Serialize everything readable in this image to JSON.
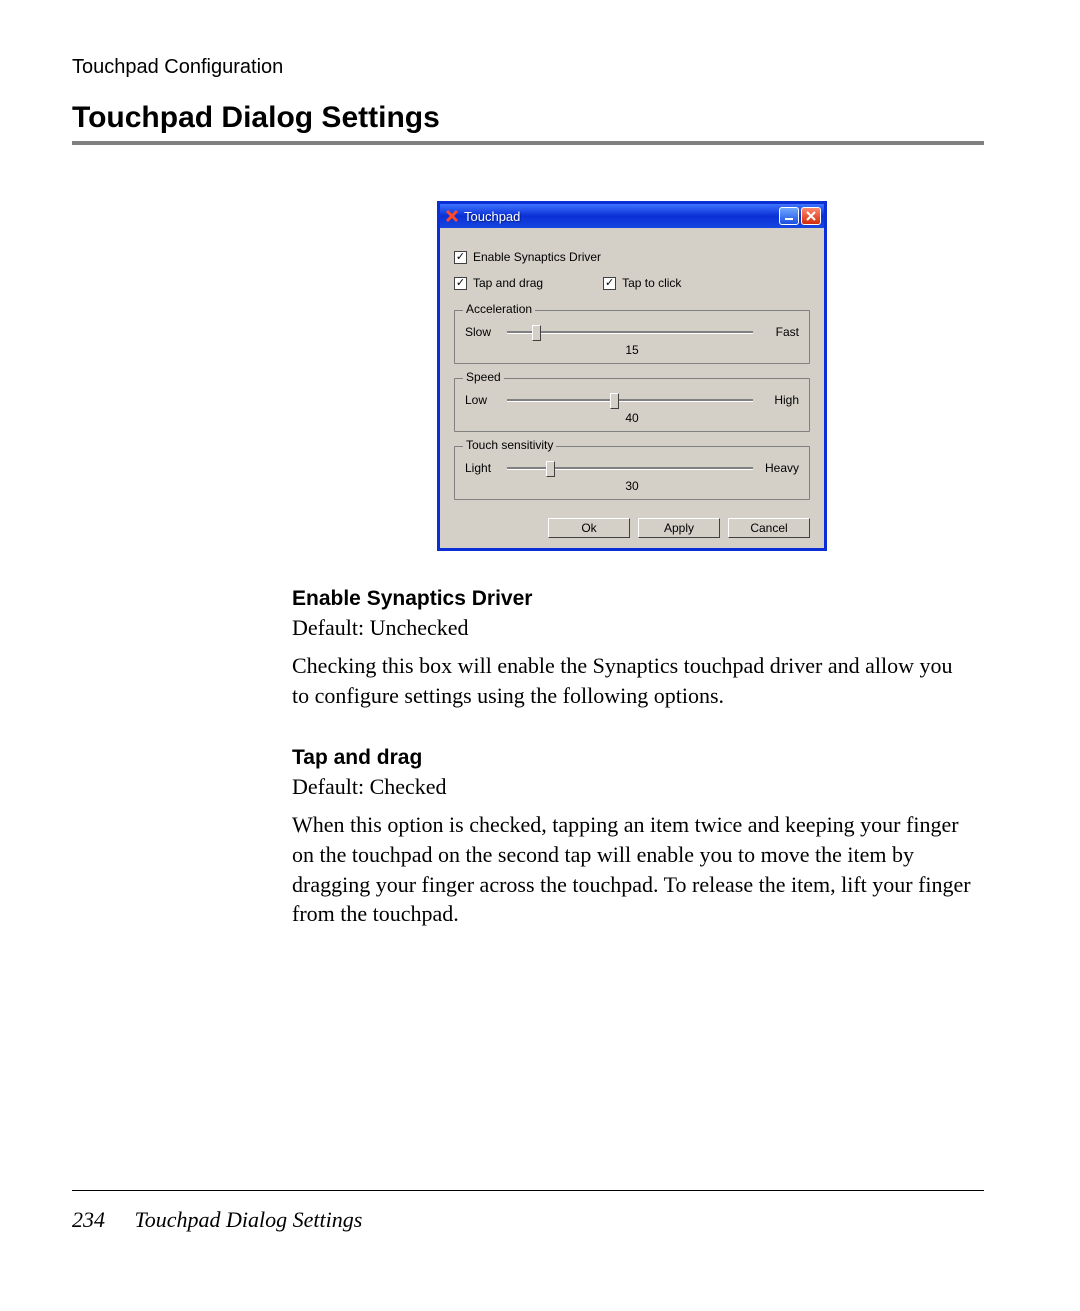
{
  "header": {
    "running_head": "Touchpad Configuration",
    "section_title": "Touchpad Dialog Settings"
  },
  "dialog": {
    "title": "Touchpad",
    "checkboxes": {
      "enable_driver": {
        "label": "Enable Synaptics Driver",
        "checked": true
      },
      "tap_and_drag": {
        "label": "Tap and drag",
        "checked": true
      },
      "tap_to_click": {
        "label": "Tap to click",
        "checked": true
      }
    },
    "groups": {
      "acceleration": {
        "legend": "Acceleration",
        "left_label": "Slow",
        "right_label": "Fast",
        "value": 15,
        "thumb_percent": 10
      },
      "speed": {
        "legend": "Speed",
        "left_label": "Low",
        "right_label": "High",
        "value": 40,
        "thumb_percent": 42
      },
      "sensitivity": {
        "legend": "Touch sensitivity",
        "left_label": "Light",
        "right_label": "Heavy",
        "value": 30,
        "thumb_percent": 16
      }
    },
    "buttons": {
      "ok": "Ok",
      "apply": "Apply",
      "cancel": "Cancel"
    }
  },
  "doc": {
    "opt1": {
      "heading": "Enable Synaptics Driver",
      "default": "Default: Unchecked",
      "body": "Checking this box will enable the Synaptics touchpad driver and allow you to configure settings using the following options."
    },
    "opt2": {
      "heading": "Tap and drag",
      "default": "Default: Checked",
      "body": "When this option is checked, tapping an item  twice and keeping your finger on the touchpad on the second tap will enable you to move the item by dragging your finger across the touchpad. To release the item, lift your finger from the touchpad."
    }
  },
  "footer": {
    "page_number": "234",
    "title": "Touchpad Dialog Settings"
  }
}
